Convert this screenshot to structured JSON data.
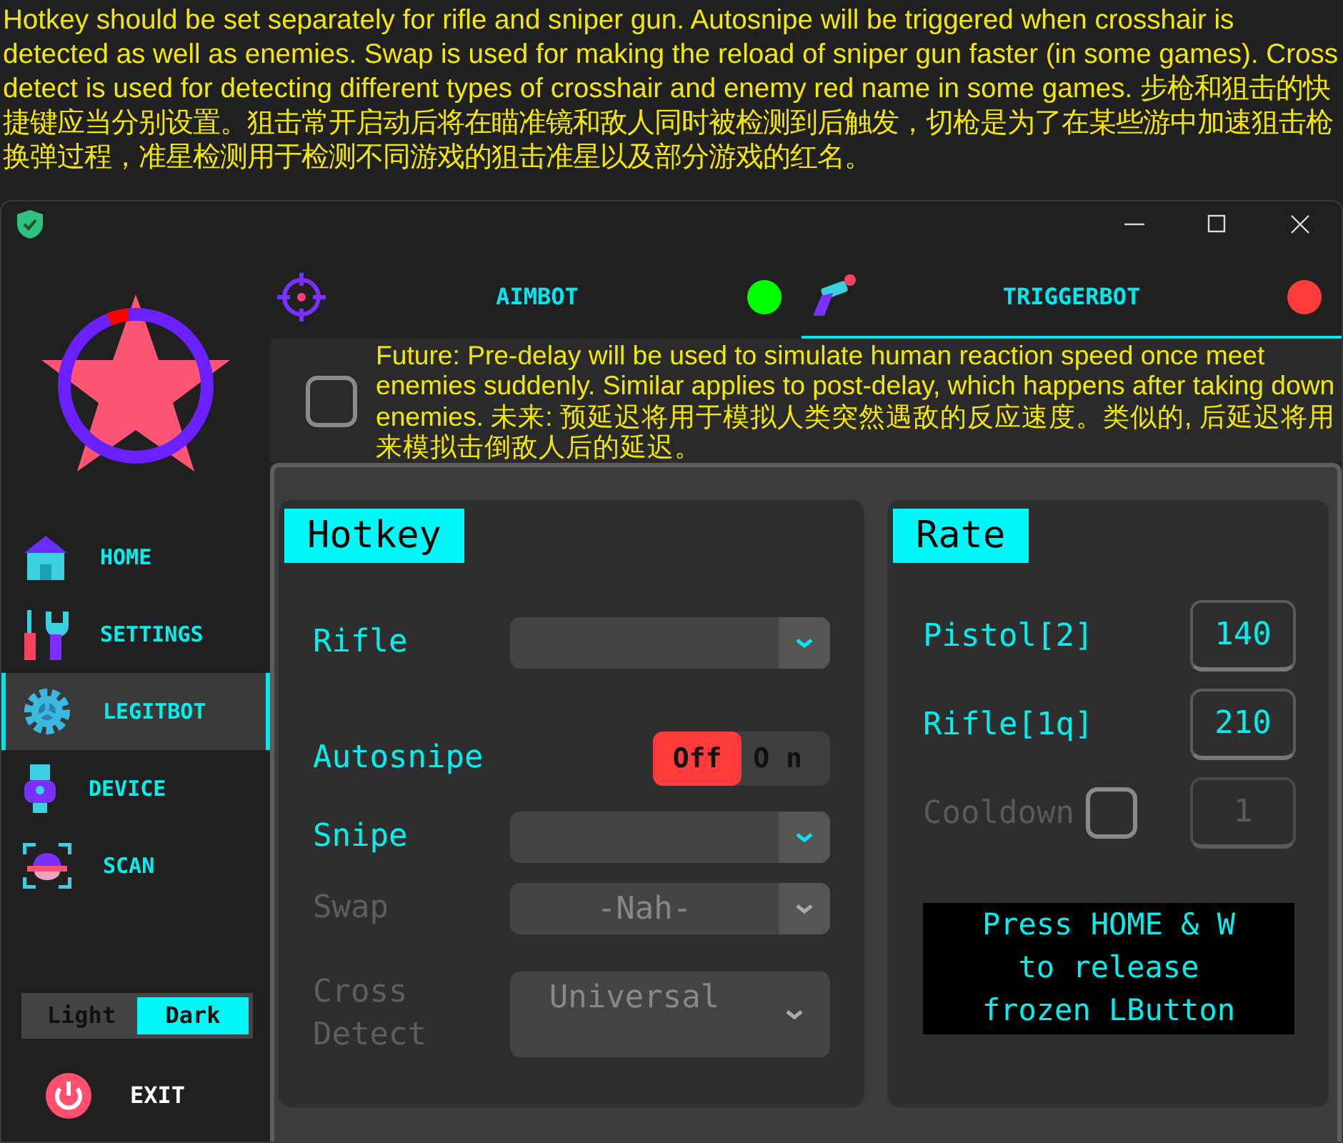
{
  "caption": "Hotkey should be set separately for rifle and sniper gun. Autosnipe will be triggered when crosshair is detected as well as enemies. Swap is used for making the reload of sniper gun faster (in some games). Cross detect is used for detecting different types of crosshair and enemy red name in some games. 步枪和狙击的快捷键应当分别设置。狙击常开启动后将在瞄准镜和敌人同时被检测到后触发，切枪是为了在某些游中加速狙击枪换弹过程，准星检测用于检测不同游戏的狙击准星以及部分游戏的红名。",
  "sidebar": {
    "items": [
      {
        "kind": "home",
        "label": "HOME",
        "selected": false
      },
      {
        "kind": "tools",
        "label": "SETTINGS",
        "selected": false
      },
      {
        "kind": "gear",
        "label": "LEGITBOT",
        "selected": true
      },
      {
        "kind": "usb",
        "label": "DEVICE",
        "selected": false
      },
      {
        "kind": "scan",
        "label": "SCAN",
        "selected": false
      }
    ],
    "theme": [
      {
        "label": "Light",
        "selected": false
      },
      {
        "label": "Dark",
        "selected": true
      }
    ],
    "exit": "EXIT"
  },
  "tabs": [
    {
      "kind": "crosshair",
      "label": "AIMBOT",
      "selected": false,
      "color": "#00ff00"
    },
    {
      "kind": "gun",
      "label": "TRIGGERBOT",
      "selected": true,
      "color": "#ff3b3b"
    }
  ],
  "notice": {
    "checked": false,
    "text": "Future: Pre-delay will be used to simulate human reaction speed once meet enemies suddenly. Similar applies to post-delay, which happens after taking down enemies. 未来: 预延迟将用于模拟人类突然遇敌的反应速度。类似的, 后延迟将用来模拟击倒敌人后的延迟。"
  },
  "hotkey": {
    "title": "Hotkey",
    "rows": [
      {
        "kind": "dropdown",
        "label": "Rifle",
        "disabled": false
      },
      {
        "kind": "toggle",
        "label": "Autosnipe",
        "options": [
          {
            "label": "Off",
            "selected": true
          },
          {
            "label": "On",
            "selected": false
          }
        ]
      },
      {
        "kind": "dropdown",
        "label": "Snipe",
        "disabled": false
      },
      {
        "kind": "dropdown",
        "label": "Swap",
        "value": "-Nah-",
        "disabled": true
      },
      {
        "kind": "tall-dropdown",
        "label": "Cross Detect",
        "value": "Universal",
        "disabled": true
      }
    ]
  },
  "rate": {
    "title": "Rate",
    "rows": [
      {
        "kind": "number",
        "label": "Pistol[2]",
        "value": "140",
        "disabled": false
      },
      {
        "kind": "number",
        "label": "Rifle[1q]",
        "value": "210",
        "disabled": false
      },
      {
        "kind": "check-number",
        "label": "Cooldown",
        "checked": false,
        "value": "1",
        "disabled": true
      }
    ],
    "note": [
      "Press HOME & W",
      "to release",
      "frozen LButton"
    ]
  }
}
